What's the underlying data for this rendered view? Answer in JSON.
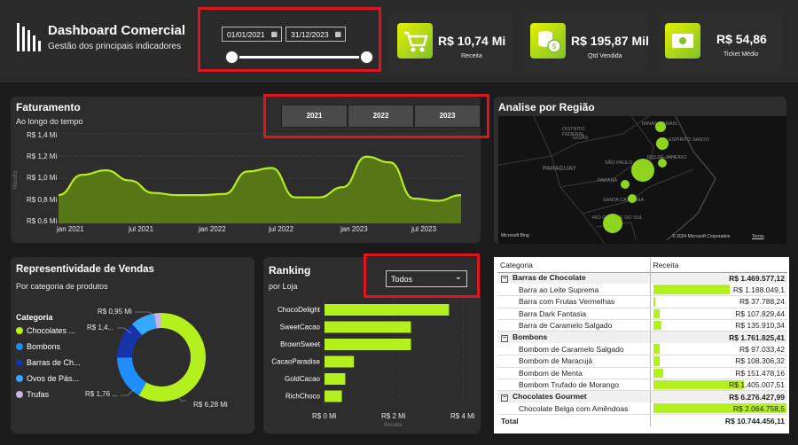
{
  "header": {
    "title": "Dashboard Comercial",
    "subtitle": "Gestão dos principais indicadores",
    "date_start": "01/01/2021",
    "date_end": "31/12/2023"
  },
  "kpis": [
    {
      "value": "R$ 10,74 Mi",
      "label": "Receita",
      "icon": "cart-icon"
    },
    {
      "value": "R$ 195,87 Mil",
      "label": "Qtd Vendida",
      "icon": "coins-icon"
    },
    {
      "value": "R$ 54,86",
      "label": "Ticket Médio",
      "icon": "money-icon"
    }
  ],
  "faturamento": {
    "title": "Faturamento",
    "subtitle": "Ao longo do tempo",
    "year_buttons": [
      "2021",
      "2022",
      "2023"
    ],
    "ylabel": "Receita",
    "chart_data": {
      "type": "area",
      "title": "Faturamento",
      "ylabel": "Receita",
      "ylim": [
        0.6,
        1.4
      ],
      "y_ticks": [
        "R$ 1,4 Mi",
        "R$ 1,2 Mi",
        "R$ 1,0 Mi",
        "R$ 0,8 Mi",
        "R$ 0,6 Mi"
      ],
      "x_ticks": [
        "jan 2021",
        "jul 2021",
        "jan 2022",
        "jul 2022",
        "jan 2023",
        "jul 2023"
      ],
      "x": [
        0,
        2,
        4,
        6,
        8,
        10,
        12,
        14,
        16,
        18,
        20,
        22,
        24,
        26,
        28,
        30,
        32,
        34
      ],
      "values": [
        0.85,
        1.03,
        1.07,
        0.98,
        0.87,
        0.85,
        0.85,
        0.86,
        1.06,
        1.09,
        0.83,
        0.83,
        0.92,
        1.19,
        1.14,
        0.82,
        0.8,
        0.85
      ],
      "color": "#b3f01e"
    }
  },
  "regiao": {
    "title": "Analise por Região",
    "map_labels": [
      "MINAS GERAIS",
      "DISTRITO FEDERAL",
      "GOIÁS",
      "ESPÍRITO SANTO",
      "PARAGUAY",
      "PARANÁ",
      "SÃO PAULO",
      "RIO DE JANEIRO",
      "SANTA CATARINA",
      "RIO GRANDE DO SUL"
    ],
    "bing": "Microsoft Bing",
    "copyright": "© 2024 Microsoft Corporation",
    "terms": "Terms"
  },
  "representatividade": {
    "title": "Representividade de Vendas",
    "subtitle": "Por categoria de produtos",
    "legend_title": "Categoria",
    "legend": [
      {
        "label": "Chocolates ...",
        "color": "#b3f01e"
      },
      {
        "label": "Bombons",
        "color": "#1f8fff"
      },
      {
        "label": "Barras de Ch...",
        "color": "#1733a8"
      },
      {
        "label": "Ovos de Pás...",
        "color": "#36a8ff"
      },
      {
        "label": "Trufas",
        "color": "#c9b4e8"
      }
    ],
    "data_labels": [
      "R$ 0,95 Mi",
      "R$ 1,4...",
      "R$ 1,76 ...",
      "R$ 6,28 Mi"
    ],
    "chart_data": {
      "type": "pie",
      "categories": [
        "Chocolates Gourmet",
        "Bombons",
        "Barras de Chocolate",
        "Ovos de Páscoa",
        "Trufas"
      ],
      "values": [
        6.28,
        1.76,
        1.47,
        0.95,
        0.28
      ],
      "colors": [
        "#b3f01e",
        "#1f8fff",
        "#1733a8",
        "#36a8ff",
        "#c9b4e8"
      ]
    }
  },
  "ranking": {
    "title": "Ranking",
    "subtitle": "por Loja",
    "dropdown": "Todos",
    "chart_data": {
      "type": "bar",
      "orientation": "horizontal",
      "categories": [
        "ChocoDelight",
        "SweetCacao",
        "BrownSweet",
        "CacaoParadise",
        "GoldCacao",
        "RichChoco"
      ],
      "values": [
        3.6,
        2.5,
        2.5,
        0.85,
        0.6,
        0.5
      ],
      "xlim": [
        0,
        4
      ],
      "x_ticks": [
        "R$ 0 Mi",
        "R$ 2 Mi",
        "R$ 4 Mi"
      ],
      "xlabel": "Receita",
      "color": "#b3f01e"
    }
  },
  "matrix": {
    "col_categoria": "Categoria",
    "col_receita": "Receita",
    "max": 2064758.5,
    "rows": [
      {
        "type": "group",
        "name": "Barras de Chocolate",
        "value": "R$ 1.469.577,12"
      },
      {
        "type": "item",
        "name": "Barra ao Leite Suprema",
        "value": "R$ 1.188.049,1",
        "num": 1188049.1
      },
      {
        "type": "item",
        "name": "Barra com Frutas Vermelhas",
        "value": "R$ 37.788,24",
        "num": 37788.24
      },
      {
        "type": "item",
        "name": "Barra Dark Fantasia",
        "value": "R$ 107.829,44",
        "num": 107829.44
      },
      {
        "type": "item",
        "name": "Barra de Caramelo Salgado",
        "value": "R$ 135.910,34",
        "num": 135910.34
      },
      {
        "type": "group",
        "name": "Bombons",
        "value": "R$ 1.761.825,41"
      },
      {
        "type": "item",
        "name": "Bombom de Caramelo Salgado",
        "value": "R$ 97.033,42",
        "num": 97033.42
      },
      {
        "type": "item",
        "name": "Bombom de Maracujá",
        "value": "R$ 108.306,32",
        "num": 108306.32
      },
      {
        "type": "item",
        "name": "Bombom de Menta",
        "value": "R$ 151.478,16",
        "num": 151478.16
      },
      {
        "type": "item",
        "name": "Bombom Trufado de Morango",
        "value": "R$ 1.405.007,51",
        "num": 1405007.51
      },
      {
        "type": "group",
        "name": "Chocolates Gourmet",
        "value": "R$ 6.276.427,99"
      },
      {
        "type": "item",
        "name": "Chocolate Belga com Amêndoas",
        "value": "R$ 2.064.758,5",
        "num": 2064758.5
      }
    ],
    "total_label": "Total",
    "total_value": "R$ 10.744.456,11"
  }
}
